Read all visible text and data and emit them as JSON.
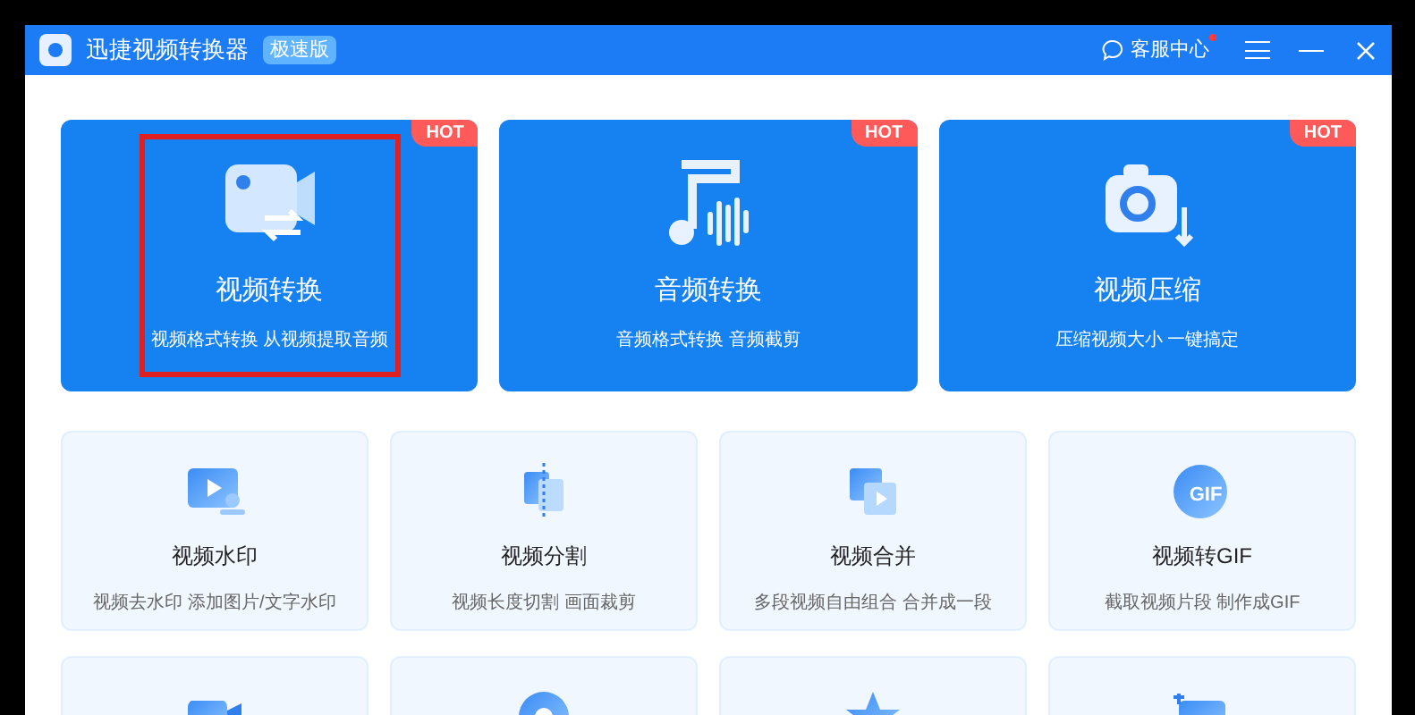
{
  "window": {
    "title": "迅捷视频转换器",
    "edition_badge": "极速版",
    "support": {
      "label": "客服中心",
      "unread": true
    }
  },
  "featured": [
    {
      "kind": "video-convert",
      "title": "视频转换",
      "subtitle": "视频格式转换 从视频提取音频",
      "hot": "HOT",
      "highlighted": true
    },
    {
      "kind": "audio-convert",
      "title": "音频转换",
      "subtitle": "音频格式转换 音频截剪",
      "hot": "HOT",
      "highlighted": false
    },
    {
      "kind": "compress",
      "title": "视频压缩",
      "subtitle": "压缩视频大小 一键搞定",
      "hot": "HOT",
      "highlighted": false
    }
  ],
  "tools": [
    {
      "kind": "watermark",
      "title": "视频水印",
      "subtitle": "视频去水印 添加图片/文字水印"
    },
    {
      "kind": "split",
      "title": "视频分割",
      "subtitle": "视频长度切割 画面裁剪"
    },
    {
      "kind": "merge",
      "title": "视频合并",
      "subtitle": "多段视频自由组合 合并成一段"
    },
    {
      "kind": "gif",
      "title": "视频转GIF",
      "subtitle": "截取视频片段 制作成GIF",
      "icon_text": "GIF"
    },
    {
      "kind": "camera"
    },
    {
      "kind": "disc"
    },
    {
      "kind": "star"
    },
    {
      "kind": "screen"
    }
  ]
}
